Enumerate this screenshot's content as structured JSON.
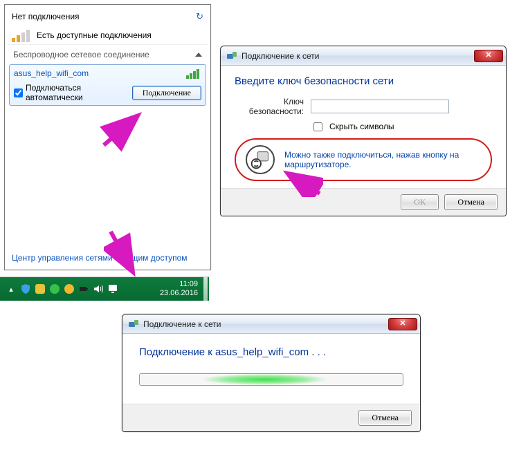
{
  "flyout": {
    "title": "Нет подключения",
    "avail": "Есть доступные подключения",
    "section": "Беспроводное сетевое соединение",
    "net_name": "asus_help_wifi_com",
    "auto_connect": "Подключаться автоматически",
    "connect_btn": "Подключение",
    "footer_link": "Центр управления сетями и общим доступом"
  },
  "dialog1": {
    "title": "Подключение к сети",
    "heading": "Введите ключ безопасности сети",
    "key_label": "Ключ безопасности:",
    "hide_label": "Скрыть символы",
    "hint": "Можно также подключиться, нажав кнопку на маршрутизаторе.",
    "ok": "OK",
    "cancel": "Отмена"
  },
  "dialog2": {
    "title": "Подключение к сети",
    "status": "Подключение к asus_help_wifi_com . . .",
    "cancel": "Отмена"
  },
  "taskbar": {
    "time": "11:09",
    "date": "23.06.2016"
  }
}
